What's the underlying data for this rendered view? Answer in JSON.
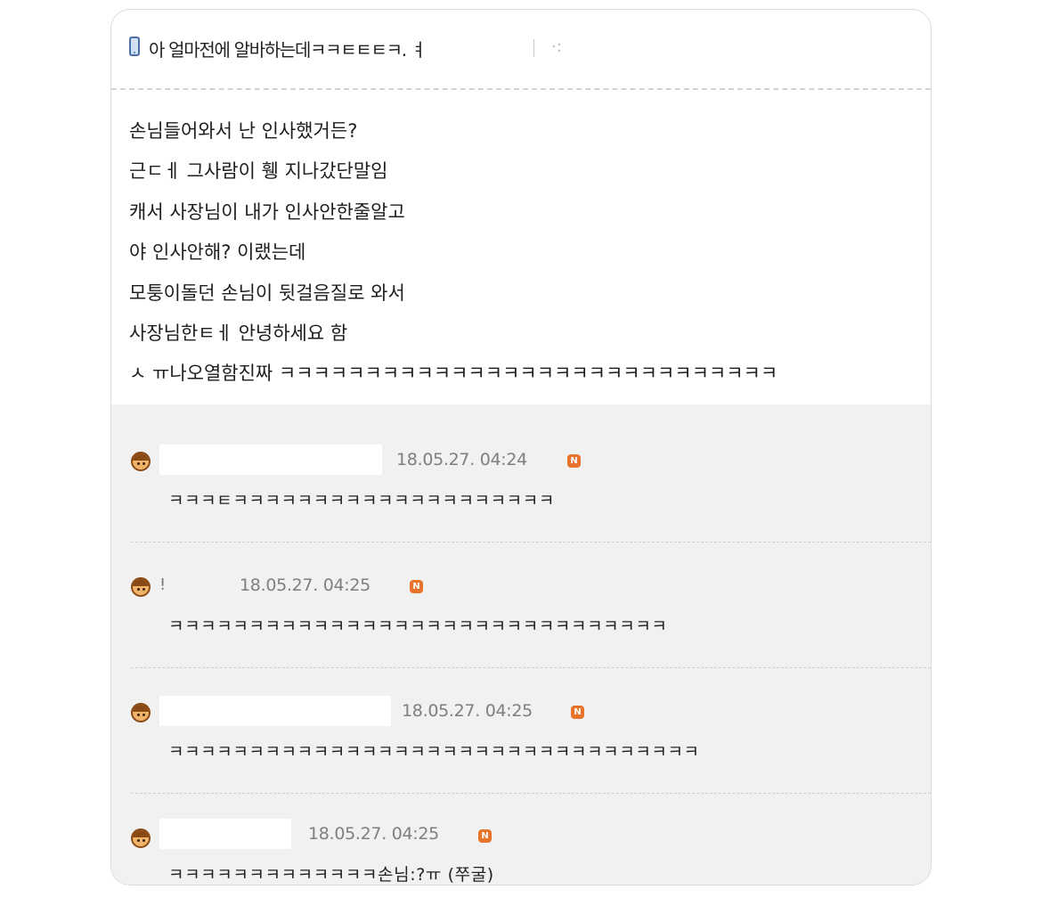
{
  "post": {
    "title": "아 얼마전에 알바하는데ㅋㅋㅌㅌㅌㅋ. ㅕ",
    "title_mark": "·:",
    "body_lines": [
      "손님들어와서 난 인사했거든?",
      "근ㄷㅔ 그사람이 휑 지나갔단말임",
      "캐서 사장님이 내가 인사안한줄알고",
      "야 인사안해? 이랬는데",
      "모퉁이돌던 손님이 뒷걸음질로 와서",
      "사장님한ㅌㅔ 안녕하세요 함",
      "ㅅ ㅠ나오열함진짜 ㅋㅋㅋㅋㅋㅋㅋㅋㅋㅋㅋㅋㅋㅋㅋㅋㅋㅋㅋㅋㅋㅋㅋㅋㅋㅋㅋㅋㅋ"
    ]
  },
  "comments": [
    {
      "name": "",
      "date": "18.05.27. 04:24",
      "badge": "N",
      "text": "ㅋㅋㅋㅌㅋㅋㅋㅋㅋㅋㅋㅋㅋㅋㅋㅋㅋㅋㅋㅋㅋㅋㅋㅋ"
    },
    {
      "name": "!",
      "date": "18.05.27. 04:25",
      "badge": "N",
      "text": "ㅋㅋㅋㅋㅋㅋㅋㅋㅋㅋㅋㅋㅋㅋㅋㅋㅋㅋㅋㅋㅋㅋㅋㅋㅋㅋㅋㅋㅋㅋㅋ"
    },
    {
      "name": "",
      "date": "18.05.27. 04:25",
      "badge": "N",
      "text": "ㅋㅋㅋㅋㅋㅋㅋㅋㅋㅋㅋㅋㅋㅋㅋㅋㅋㅋㅋㅋㅋㅋㅋㅋㅋㅋㅋㅋㅋㅋㅋㅋㅋ"
    },
    {
      "name": "",
      "date": "18.05.27. 04:25",
      "badge": "N",
      "text": "ㅋㅋㅋㅋㅋㅋㅋㅋㅋㅋㅋㅋㅋ손님:?ㅠ (쭈굴)"
    }
  ]
}
